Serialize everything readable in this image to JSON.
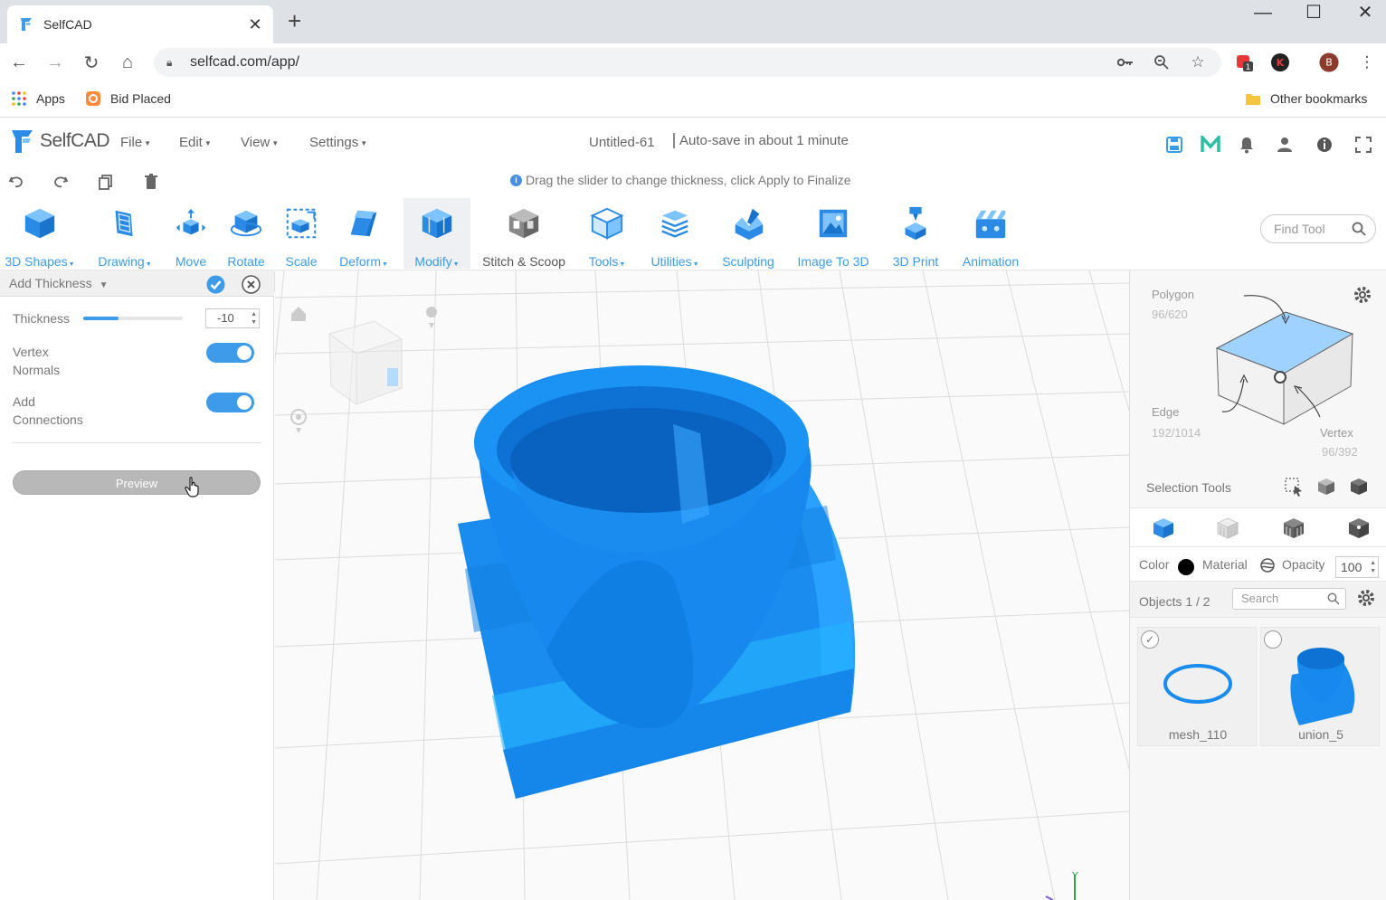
{
  "browser": {
    "tab_title": "SelfCAD",
    "tab_close": "✕",
    "new_tab": "+",
    "url": "selfcad.com/app/",
    "bookmarks": [
      {
        "label": "Apps"
      },
      {
        "label": "Bid Placed"
      }
    ],
    "other_bookmarks": "Other bookmarks",
    "profile_initial": "B",
    "ext_badge": "1",
    "ext_k": "K"
  },
  "app": {
    "logo_text": "SelfCAD",
    "menus": [
      "File",
      "Edit",
      "View",
      "Settings"
    ],
    "doc_title": "Untitled-61",
    "autosave": "Auto-save in about 1 minute",
    "hint": "Drag the slider to change thickness, click Apply to Finalize"
  },
  "toolbar": {
    "tools": [
      {
        "label": "3D Shapes",
        "dropdown": true
      },
      {
        "label": "Drawing",
        "dropdown": true
      },
      {
        "label": "Move",
        "dropdown": false
      },
      {
        "label": "Rotate",
        "dropdown": false
      },
      {
        "label": "Scale",
        "dropdown": false
      },
      {
        "label": "Deform",
        "dropdown": true
      },
      {
        "label": "Modify",
        "dropdown": true
      },
      {
        "label": "Stitch & Scoop",
        "dropdown": false
      },
      {
        "label": "Tools",
        "dropdown": true
      },
      {
        "label": "Utilities",
        "dropdown": true
      },
      {
        "label": "Sculpting",
        "dropdown": false
      },
      {
        "label": "Image To 3D",
        "dropdown": false
      },
      {
        "label": "3D Print",
        "dropdown": false
      },
      {
        "label": "Animation",
        "dropdown": false
      }
    ],
    "find_tool_placeholder": "Find Tool"
  },
  "left_panel": {
    "title": "Add Thickness",
    "thickness_label": "Thickness",
    "thickness_value": "-10",
    "thickness_slider_fraction": 0.35,
    "vertex_normals_line1": "Vertex",
    "vertex_normals_line2": "Normals",
    "vertex_normals_on": true,
    "add_connections_line1": "Add",
    "add_connections_line2": "Connections",
    "add_connections_on": true,
    "preview_label": "Preview",
    "collapse": "<"
  },
  "right_panel": {
    "polygon_label": "Polygon",
    "polygon_count": "96/620",
    "edge_label": "Edge",
    "edge_count": "192/1014",
    "vertex_label": "Vertex",
    "vertex_count": "96/392",
    "selection_tools_label": "Selection Tools",
    "color_label": "Color",
    "color_value": "#000000",
    "material_label": "Material",
    "opacity_label": "Opacity",
    "opacity_value": "100",
    "objects_label": "Objects 1 / 2",
    "search_placeholder": "Search",
    "objects": [
      {
        "name": "mesh_110",
        "checked": true
      },
      {
        "name": "union_5",
        "checked": false
      }
    ]
  },
  "viewport": {
    "axis_label": "Y"
  },
  "colors": {
    "accent": "#3d9be9",
    "model": "#1a8cf0"
  }
}
